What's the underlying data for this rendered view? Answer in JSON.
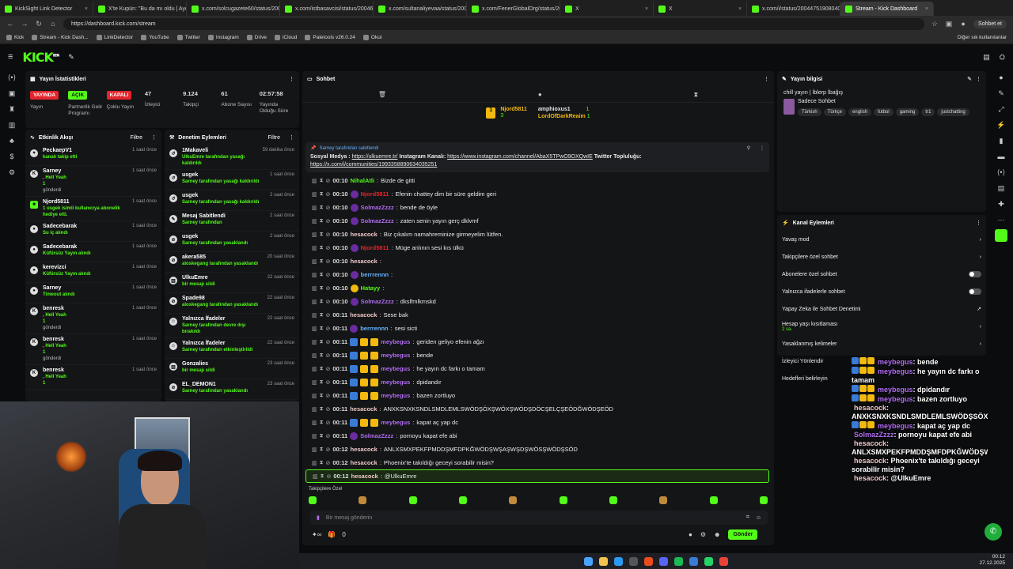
{
  "browser": {
    "tabs": [
      {
        "title": "KickSight Link Detector",
        "active": false
      },
      {
        "title": "X'te Kupün: \"Bu da mı oldu | Aydı",
        "active": false
      },
      {
        "title": "x.com/solcugazete60/status/200",
        "active": false
      },
      {
        "title": "x.com/istbasavcisi/status/20046",
        "active": false
      },
      {
        "title": "x.com/sultanaliyevaa/status/200",
        "active": false
      },
      {
        "title": "x.com/FenerGlobalOrg/status/20",
        "active": false
      },
      {
        "title": "X",
        "active": false
      },
      {
        "title": "X",
        "active": false
      },
      {
        "title": "x.com/i/status/200447519080400",
        "active": false
      },
      {
        "title": "Stream - Kick Dashboard",
        "active": true
      }
    ],
    "url": "https://dashboard.kick.com/stream",
    "profile_label": "Sohbet et",
    "bookmarks": [
      "Kick",
      "Stream - Kick Dash...",
      "LinkDetector",
      "YouTube",
      "Twitter",
      "Instagram",
      "Drive",
      "iCloud",
      "Paletools v26.0.24",
      "Okul"
    ],
    "other_bookmarks": "Diğer sık kullanılanlar"
  },
  "kick": {
    "logo": "KICK",
    "logo_sup": "BETA"
  },
  "stats": {
    "title": "Yayın İstatistikleri",
    "items": [
      {
        "pill": "YAYINDA",
        "color": "#e3252d",
        "label": "Yayın"
      },
      {
        "pill": "AÇIK",
        "color": "#53fc18",
        "label": "Partnerlik Gelir Programı"
      },
      {
        "pill": "KAPALI",
        "color": "#e3252d",
        "label": "Çoklu Yayın"
      },
      {
        "value": "47",
        "label": "İzleyici"
      },
      {
        "value": "9.124",
        "label": "Takipçi"
      },
      {
        "value": "61",
        "label": "Abone Sayısı"
      },
      {
        "value": "02:57:58",
        "label": "Yayında Olduğu Süre"
      }
    ]
  },
  "activity": {
    "title": "Etkinlik Akışı",
    "filter": "Filtre",
    "rows": [
      {
        "icon": "heart",
        "name": "PeckaepV1",
        "sub": "kanalı takip etti",
        "time": "1 saat önce"
      },
      {
        "icon": "kick",
        "name": "Sarney",
        "sub": ", Hell Yeah",
        "sub2": "1",
        "sub3": "gönderdi",
        "time": "1 saat önce"
      },
      {
        "icon": "gift",
        "name": "Njord5811",
        "sub": "1 usgek isimli kullanıcıya abonelik hediye etti.",
        "time": "1 saat önce"
      },
      {
        "icon": "star",
        "name": "Sadecebarak",
        "sub": "Su iç alındı",
        "time": "1 saat önce"
      },
      {
        "icon": "star",
        "name": "Sadecebarak",
        "sub": "Küfürsüz Yayın alındı",
        "time": "1 saat önce"
      },
      {
        "icon": "star",
        "name": "kerevizci",
        "sub": "Küfürsüz Yayın alındı",
        "time": "1 saat önce"
      },
      {
        "icon": "star",
        "name": "Sarney",
        "sub": "Timeout alındı",
        "time": "1 saat önce"
      },
      {
        "icon": "kick",
        "name": "benresk",
        "sub": ", Hell Yeah",
        "sub2": "1",
        "sub3": "gönderdi",
        "time": "1 saat önce"
      },
      {
        "icon": "kick",
        "name": "benresk",
        "sub": ", Hell Yeah",
        "sub2": "1",
        "sub3": "gönderdi",
        "time": "1 saat önce"
      },
      {
        "icon": "kick",
        "name": "benresk",
        "sub": ", Hell Yeah",
        "sub2": "1",
        "time": "1 saat önce"
      }
    ]
  },
  "moderation": {
    "title": "Denetim Eylemleri",
    "filter": "Filtre",
    "rows": [
      {
        "icon": "undo",
        "name": "1Makaveli",
        "sub": "UlkuEmre tarafından yasağı kaldırıldı",
        "time": "59 dakika önce"
      },
      {
        "icon": "undo",
        "name": "usgek",
        "sub": "Sarney tarafından yasağı kaldırıldı",
        "time": "1 saat önce"
      },
      {
        "icon": "undo",
        "name": "usgek",
        "sub": "Sarney tarafından yasağı kaldırıldı",
        "time": "2 saat önce"
      },
      {
        "icon": "pin",
        "name": "Mesaj Sabitlendi",
        "sub": "Sarney tarafından",
        "time": "2 saat önce"
      },
      {
        "icon": "ban",
        "name": "usgek",
        "sub": "Sarney tarafından yasaklandı",
        "time": "2 saat önce"
      },
      {
        "icon": "ban",
        "name": "akera585",
        "sub": "aloskegang tarafından yasaklandı",
        "time": "20 saat önce"
      },
      {
        "icon": "trash",
        "name": "UlkuEmre",
        "sub": "bir mesajı sildi",
        "time": "22 saat önce"
      },
      {
        "icon": "ban",
        "name": "Spade98",
        "sub": "aloskegang tarafından yasaklandı",
        "time": "22 saat önce"
      },
      {
        "icon": "emote",
        "name": "Yalnızca İfadeler",
        "sub": "Sarney tarafından devre dışı bırakıldı",
        "time": "22 saat önce"
      },
      {
        "icon": "emote",
        "name": "Yalnızca İfadeler",
        "sub": "Sarney tarafından etkinleştirildi",
        "time": "22 saat önce"
      },
      {
        "icon": "trash",
        "name": "Gonzalies",
        "sub": "bir mesajı sildi",
        "time": "23 saat önce"
      },
      {
        "icon": "ban",
        "name": "EL_DEMON1",
        "sub": "Sarney tarafından yasaklandı",
        "time": "23 saat önce"
      }
    ]
  },
  "chat": {
    "title": "Sohbet",
    "gifters": [
      {
        "name": "Njord5811",
        "count": "3"
      },
      {
        "name": "amphioxus1",
        "count": "1"
      },
      {
        "name": "LordOfDarkReaim",
        "count": "1"
      }
    ],
    "pinned": {
      "by": "Sarney tarafından sabitlendi",
      "text1": "Sosyal Medya : ",
      "link1": "https://ulkuemre.tr/",
      "text2": " Instagram Kanalı: ",
      "link2": "https://www.instagram.com/channel/AbaX5TPwO9OXQwIE",
      "text3": " Twitter Topluluğu:",
      "link3": "https://x.com/i/communities/1993358890634035251"
    },
    "messages": [
      {
        "time": "00:10",
        "user": "NihalAtli",
        "color": "#53fc18",
        "text": "Bizde de gitti"
      },
      {
        "time": "00:10",
        "user": "Njord5811",
        "color": "#e3252d",
        "text": "Efenin chattey dim bir süre geldim geri"
      },
      {
        "time": "00:10",
        "user": "SolmazZzzz",
        "color": "#b16cf2",
        "text": "bende de öyle"
      },
      {
        "time": "00:10",
        "user": "SolmazZzzz",
        "color": "#b16cf2",
        "text": "zaten senin yayın gerç dklvmf"
      },
      {
        "time": "00:10",
        "user": "hesacock",
        "color": "#f0c8c8",
        "text": "Biz çıkalım namahreminize girmeyelim lütfen."
      },
      {
        "time": "00:10",
        "user": "Njord5811",
        "color": "#e3252d",
        "text": "Müge anlının sesi kıs ülkü"
      },
      {
        "time": "00:10",
        "user": "hesacock",
        "color": "#f0c8c8",
        "text": ""
      },
      {
        "time": "00:10",
        "user": "berrrennn",
        "color": "#66b3ff",
        "text": ""
      },
      {
        "time": "00:10",
        "user": "Hatayy",
        "color": "#53fc18",
        "text": ""
      },
      {
        "time": "00:10",
        "user": "SolmazZzzz",
        "color": "#b16cf2",
        "text": "dkslfmlkmskd"
      },
      {
        "time": "00:11",
        "user": "hesacock",
        "color": "#f0c8c8",
        "text": "Sese bak"
      },
      {
        "time": "00:11",
        "user": "berrrennn",
        "color": "#66b3ff",
        "text": "sesi sicti"
      },
      {
        "time": "00:11",
        "user": "meybegus",
        "color": "#b16cf2",
        "text": "geriden geliyo efenin ağzı"
      },
      {
        "time": "00:11",
        "user": "meybegus",
        "color": "#b16cf2",
        "text": "bende"
      },
      {
        "time": "00:11",
        "user": "meybegus",
        "color": "#b16cf2",
        "text": "he yayın dc farkı o tamam"
      },
      {
        "time": "00:11",
        "user": "meybegus",
        "color": "#b16cf2",
        "text": "dpidandır"
      },
      {
        "time": "00:11",
        "user": "meybegus",
        "color": "#b16cf2",
        "text": "bazen zortluyo"
      },
      {
        "time": "00:11",
        "user": "hesacock",
        "color": "#f0c8c8",
        "text": "ANXKSNXKSNDLSMDLEMLSWÖDŞÖXŞWÖXŞWÖDŞDÖCŞELÇŞEÖDĞWÖDŞEÖD"
      },
      {
        "time": "00:11",
        "user": "meybegus",
        "color": "#b16cf2",
        "text": "kapat aç yap dc"
      },
      {
        "time": "00:11",
        "user": "SolmazZzzz",
        "color": "#b16cf2",
        "text": "pornoyu kapat efe abi"
      },
      {
        "time": "00:12",
        "user": "hesacock",
        "color": "#f0c8c8",
        "text": "ANLXSMXPEKFPMDDŞMFDPKĞWÖDŞWŞAŞWŞDŞWÖSŞWÖDŞSÖD"
      },
      {
        "time": "00:12",
        "user": "hesacock",
        "color": "#f0c8c8",
        "text": "Phoenix'te takıldığı geceyi sorabilir misin?"
      },
      {
        "time": "00:12",
        "user": "hesacock",
        "color": "#f0c8c8",
        "text": "@UlkuEmre"
      }
    ],
    "followers_only": "Takipçilere Özel",
    "input_placeholder": "Bir mesaj gönderin",
    "send": "Gönder",
    "footer_count": "0"
  },
  "info": {
    "title": "Yayın bilgisi",
    "stream_title": "chill yayın | İblerp İbağış",
    "category": "Sadece Sohbet",
    "tags": [
      "Türkish",
      "Türkçe",
      "english",
      "futbol",
      "gaming",
      "tr1",
      "justchatting"
    ]
  },
  "channel_actions": {
    "title": "Kanal Eylemleri",
    "rows": [
      {
        "label": "Yavaş mod",
        "kind": "arrow"
      },
      {
        "label": "Takipçilere özel sohbet",
        "kind": "arrow"
      },
      {
        "label": "Abonelere özel sohbet",
        "kind": "toggle"
      },
      {
        "label": "Yalnızca ifadelerle sohbet",
        "kind": "toggle"
      },
      {
        "label": "Yapay Zeka ile Sohbet Denetimi",
        "kind": "link"
      },
      {
        "label": "Hesap yaşı kısıtlaması",
        "sub": "2 sa.",
        "kind": "arrow"
      },
      {
        "label": "Yasaklanmış kelimeler",
        "kind": "arrow"
      },
      {
        "label": "İzleyici Yönlendir",
        "kind": "none"
      },
      {
        "label": "Hedefleri belirleyin",
        "kind": "none"
      }
    ]
  },
  "overlay_chat": [
    {
      "user": "meybegus",
      "text": ": bende"
    },
    {
      "user": "meybegus",
      "text": ": he yayın dc farkı o tamam"
    },
    {
      "user": "meybegus",
      "text": ": dpidandır"
    },
    {
      "user": "meybegus",
      "text": ": bazen zortluyo"
    },
    {
      "user": "hesacock",
      "text": ":"
    },
    {
      "user": "",
      "text": "ANXKSNXKSNDLSMDLEMLSWÖDŞSÖXŞWÖXŞWÖDŞDÖCŞELÇŞEÖDĞWÖDŞEÖD"
    },
    {
      "user": "meybegus",
      "text": ": kapat aç yap dc"
    },
    {
      "user": "SolmazZzzz",
      "text": ": pornoyu kapat efe abi"
    },
    {
      "user": "hesacock",
      "text": ":"
    },
    {
      "user": "",
      "text": "ANLXSMXPEKFPMDDŞMFDPKĞWÖDŞWŞAŞWŞDŞWÖSŞWÖDŞSÖD"
    },
    {
      "user": "hesacock",
      "text": ": Phoenix'te takıldığı geceyi sorabilir misin?"
    },
    {
      "user": "hesacock",
      "text": ": @UlkuEmre"
    }
  ],
  "taskbar": {
    "time": "00:12",
    "date": "27.12.2025"
  }
}
